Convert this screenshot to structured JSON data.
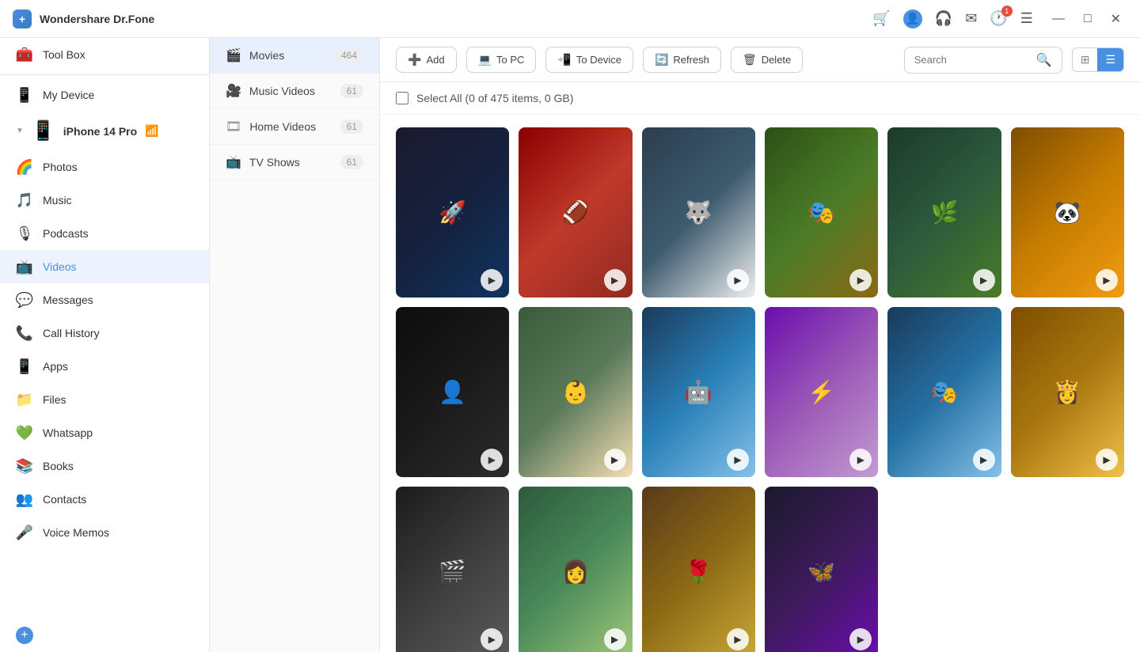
{
  "app": {
    "name": "Wondershare Dr.Fone",
    "logo_char": "+"
  },
  "titlebar": {
    "cart_icon": "🛒",
    "profile_icon": "👤",
    "headset_icon": "🎧",
    "mail_icon": "✉",
    "history_icon": "🕐",
    "list_icon": "☰",
    "minimize": "—",
    "maximize": "□",
    "close": "✕"
  },
  "sidebar": {
    "toolbox_label": "Tool Box",
    "my_device_label": "My Device",
    "device_name": "iPhone 14 Pro",
    "items": [
      {
        "id": "photos",
        "label": "Photos",
        "icon": "🌈"
      },
      {
        "id": "music",
        "label": "Music",
        "icon": "🎵"
      },
      {
        "id": "podcasts",
        "label": "Podcasts",
        "icon": "🎙"
      },
      {
        "id": "videos",
        "label": "Videos",
        "icon": "📺",
        "active": true
      },
      {
        "id": "messages",
        "label": "Messages",
        "icon": "💬"
      },
      {
        "id": "call-history",
        "label": "Call History",
        "icon": "📞"
      },
      {
        "id": "apps",
        "label": "Apps",
        "icon": "📱"
      },
      {
        "id": "files",
        "label": "Files",
        "icon": "📁"
      },
      {
        "id": "whatsapp",
        "label": "Whatsapp",
        "icon": "💚"
      },
      {
        "id": "books",
        "label": "Books",
        "icon": "📚"
      },
      {
        "id": "contacts",
        "label": "Contacts",
        "icon": "👥"
      },
      {
        "id": "voice-memos",
        "label": "Voice Memos",
        "icon": "🎤"
      }
    ]
  },
  "sub_sidebar": {
    "items": [
      {
        "id": "movies",
        "label": "Movies",
        "count": "464",
        "icon": "🎬",
        "active": true
      },
      {
        "id": "music-videos",
        "label": "Music Videos",
        "count": "61",
        "icon": "🎥"
      },
      {
        "id": "home-videos",
        "label": "Home Videos",
        "count": "61",
        "icon": "🎞"
      },
      {
        "id": "tv-shows",
        "label": "TV Shows",
        "count": "61",
        "icon": "📺"
      }
    ]
  },
  "toolbar": {
    "add_label": "Add",
    "to_pc_label": "To PC",
    "to_device_label": "To Device",
    "refresh_label": "Refresh",
    "delete_label": "Delete",
    "search_placeholder": "Search"
  },
  "select_all": {
    "label": "Select All (0 of 475 items, 0 GB)"
  },
  "videos": [
    {
      "id": 1,
      "color_class": "thumb-1",
      "figure": "🚀"
    },
    {
      "id": 2,
      "color_class": "thumb-2",
      "figure": "🏈"
    },
    {
      "id": 3,
      "color_class": "thumb-3",
      "figure": "🐺"
    },
    {
      "id": 4,
      "color_class": "thumb-4",
      "figure": "🎭"
    },
    {
      "id": 5,
      "color_class": "thumb-5",
      "figure": "🌿"
    },
    {
      "id": 6,
      "color_class": "thumb-6",
      "figure": "🐼"
    },
    {
      "id": 7,
      "color_class": "thumb-7",
      "figure": "👤"
    },
    {
      "id": 8,
      "color_class": "thumb-8",
      "figure": "👶"
    },
    {
      "id": 9,
      "color_class": "thumb-9",
      "figure": "🤖"
    },
    {
      "id": 10,
      "color_class": "thumb-10",
      "figure": "⚡"
    },
    {
      "id": 11,
      "color_class": "thumb-11",
      "figure": "🎭"
    },
    {
      "id": 12,
      "color_class": "thumb-12",
      "figure": "👸"
    },
    {
      "id": 13,
      "color_class": "thumb-13",
      "figure": "🎬"
    },
    {
      "id": 14,
      "color_class": "thumb-14",
      "figure": "👩"
    },
    {
      "id": 15,
      "color_class": "thumb-15",
      "figure": "🌹"
    },
    {
      "id": 16,
      "color_class": "thumb-16",
      "figure": "🦋"
    }
  ]
}
